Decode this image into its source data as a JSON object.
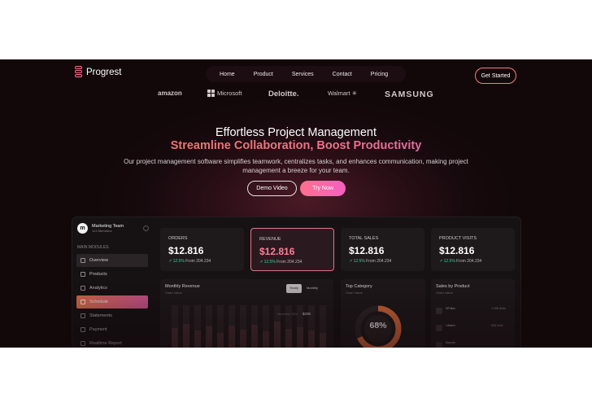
{
  "nav": {
    "brand": "Progrest",
    "links": [
      "Home",
      "Product",
      "Services",
      "Contact",
      "Pricing"
    ],
    "cta": "Get Started"
  },
  "brands": [
    "amazon",
    "Microsoft",
    "Deloitte.",
    "Walmart",
    "SAMSUNG"
  ],
  "hero": {
    "title": "Effortless Project Management",
    "subtitle": "Streamline Collaboration, Boost Productivity",
    "description": "Our project management software simplifies teamwork, centralizes tasks, and enhances communication, making project management a breeze for your team.",
    "demo_button": "Demo Video",
    "try_button": "Try Now",
    "accent_colors": [
      "#f27a52",
      "#f0718a",
      "#e55bc9"
    ]
  },
  "dashboard": {
    "team": {
      "avatar_letter": "m",
      "name": "Marketing Team",
      "members": "124 Members"
    },
    "section_label": "MAIN MODULES",
    "menu": [
      "Overview",
      "Products",
      "Analytics",
      "Schedule",
      "Statements",
      "Payment",
      "Realtime Report"
    ],
    "kpis": [
      {
        "label": "ORDERS",
        "value": "$12.816",
        "change": "12.5%",
        "from": "From 204.234"
      },
      {
        "label": "REVENUE",
        "value": "$12.816",
        "change": "12.5%",
        "from": "From 204.234"
      },
      {
        "label": "TOTAL SALES",
        "value": "$12.816",
        "change": "12.5%",
        "from": "From 204.234"
      },
      {
        "label": "PRODUCT VISITS",
        "value": "$12.816",
        "change": "12.5%",
        "from": "From 204.234"
      }
    ],
    "monthly_revenue": {
      "title": "Monthly Revenue",
      "subtitle": "Chart Value",
      "toggle": [
        "Yearly",
        "Monthly"
      ],
      "tooltip_label": "November 2024",
      "tooltip_value": "$208"
    },
    "top_category": {
      "title": "Top Category",
      "subtitle": "Chart Value",
      "percent": "68%",
      "percent_value": 0.68
    },
    "sales_by_product": {
      "title": "Sales by Product",
      "subtitle": "Chart Value",
      "rows": [
        {
          "name": "VR Box",
          "value": "1.208 Units"
        },
        {
          "name": "i-Watch",
          "value": "608 Units"
        },
        {
          "name": "Airpods",
          "value": ""
        }
      ]
    }
  }
}
